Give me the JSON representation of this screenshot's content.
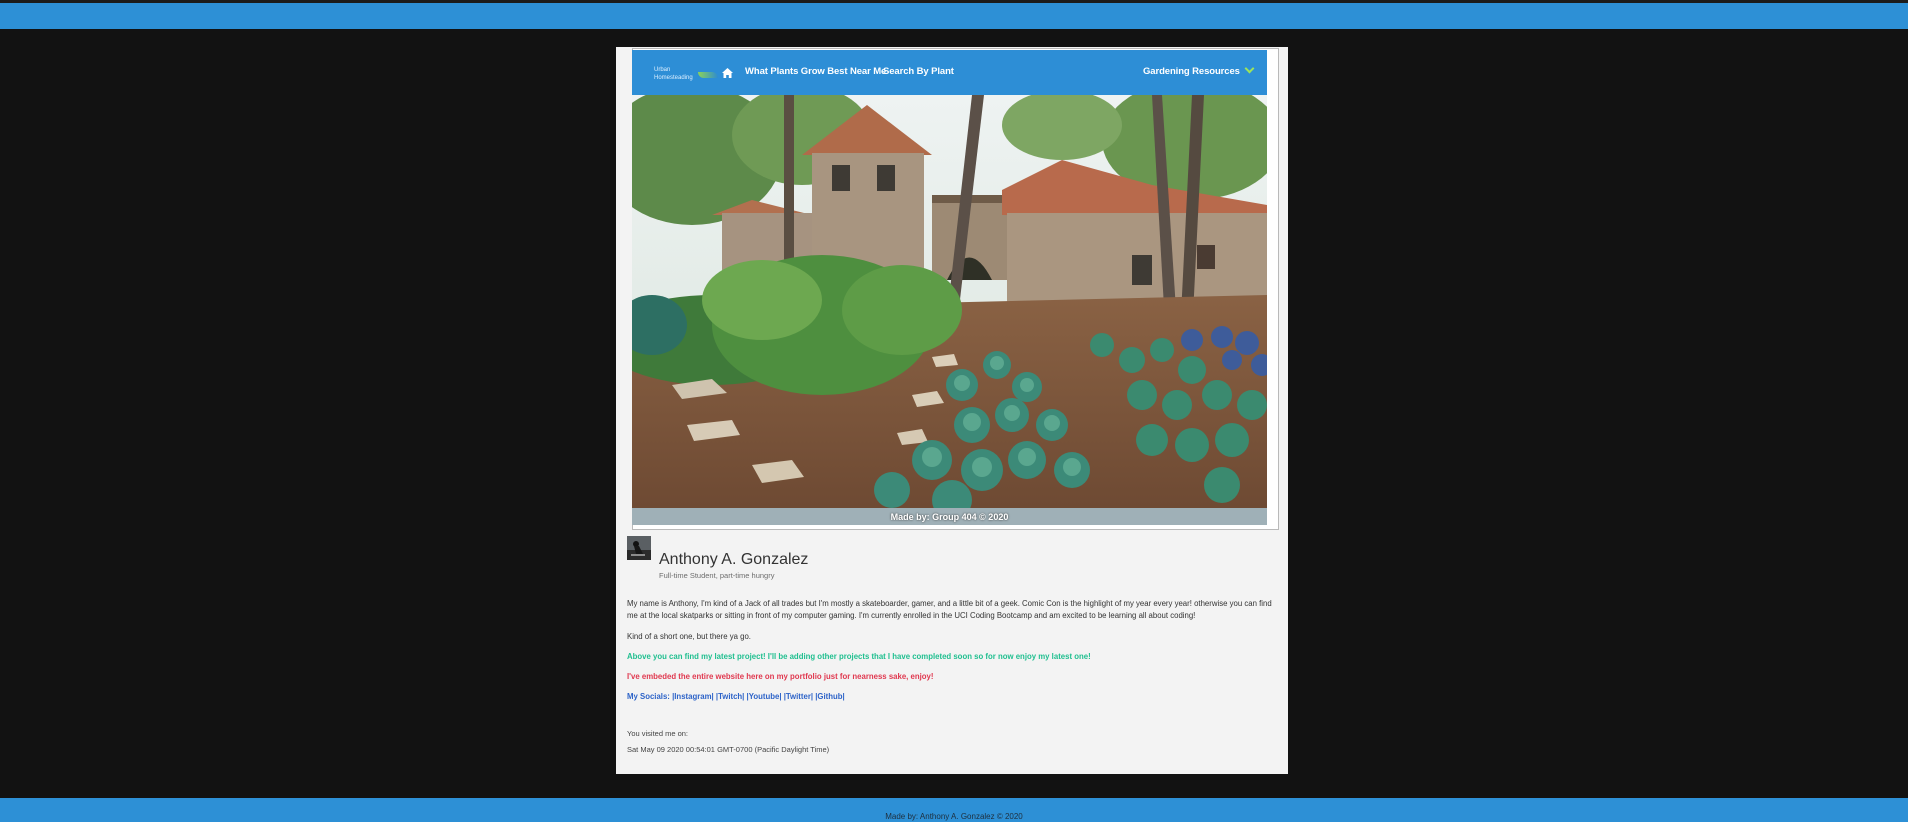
{
  "embed": {
    "logo_line1": "Urban",
    "logo_line2": "Homesteading",
    "nav": {
      "link1": "What Plants Grow Best Near Me",
      "link2": "Search By Plant",
      "dropdown": "Gardening Resources"
    },
    "footer": "Made by: Group 404 © 2020"
  },
  "profile": {
    "name": "Anthony A. Gonzalez",
    "tagline": "Full-time Student, part-time hungry"
  },
  "content": {
    "p1": "My name is Anthony, I'm kind of a Jack of all trades but I'm mostly a skateboarder, gamer, and a little bit of a geek. Comic Con is the highlight of my year every year! otherwise you can find me at the local skatparks or sitting in front of my computer gaming. I'm currently enrolled in the UCI Coding Bootcamp and am excited to be learning all about coding!",
    "p2": "Kind of a short one, but there ya go.",
    "p3": "Above you can find my latest project! I'll be adding other projects that I have completed soon so for now enjoy my latest one!",
    "p4": "I've embeded the entire website here on my portfolio just for nearness sake, enjoy!",
    "socials_label": "My Socials:",
    "socials": [
      "|Instagram|",
      "|Twitch|",
      "|Youtube|",
      "|Twitter|",
      "|Github|"
    ]
  },
  "visited": {
    "label": "You visited me on:",
    "date": "Sat May 09 2020 00:54:01 GMT-0700 (Pacific Daylight Time)"
  },
  "page_footer": "Made by: Anthony A. Gonzalez © 2020",
  "colors": {
    "bar": "#2d90d6",
    "background": "#121212",
    "card": "#f3f3f3",
    "green_text": "#1fbf8f",
    "red_text": "#e0384f",
    "blue_text": "#2d63c8"
  }
}
